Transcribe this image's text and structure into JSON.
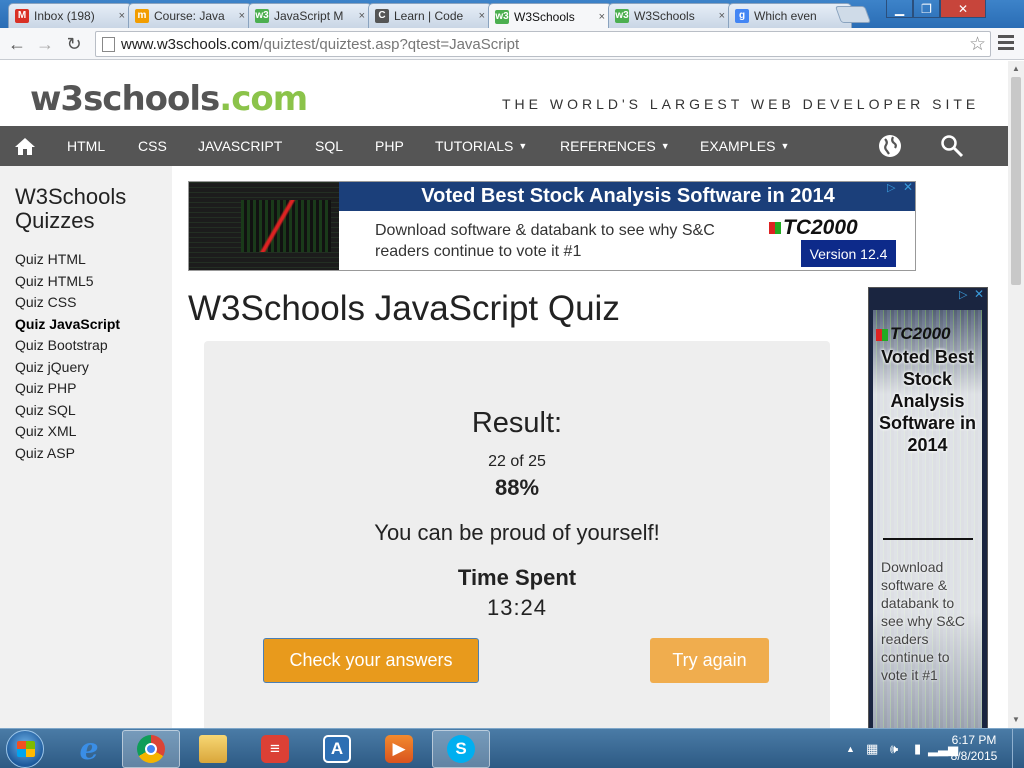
{
  "browser": {
    "tabs": [
      {
        "title": "Inbox (198)",
        "favicon": "gmail-icon",
        "color": "#d93025",
        "glyph": "M",
        "active": false
      },
      {
        "title": "Course: Java",
        "favicon": "moodle-icon",
        "color": "#f29d00",
        "glyph": "m",
        "active": false
      },
      {
        "title": "JavaScript M",
        "favicon": "w3schools-icon",
        "color": "#4caf50",
        "glyph": "w3",
        "active": false
      },
      {
        "title": "Learn | Code",
        "favicon": "codecademy-icon",
        "color": "#555555",
        "glyph": "C",
        "active": false
      },
      {
        "title": "W3Schools",
        "favicon": "w3schools-icon",
        "color": "#4caf50",
        "glyph": "w3",
        "active": true
      },
      {
        "title": "W3Schools",
        "favicon": "w3schools-icon",
        "color": "#4caf50",
        "glyph": "w3",
        "active": false
      },
      {
        "title": "Which even",
        "favicon": "google-icon",
        "color": "#4285f4",
        "glyph": "g",
        "active": false
      }
    ],
    "tab_close": "×",
    "url_host": "www.w3schools.com",
    "url_path": "/quiztest/quiztest.asp?qtest=JavaScript"
  },
  "site": {
    "logo_main": "w3schools",
    "logo_tld": ".com",
    "tagline": "THE WORLD'S LARGEST WEB DEVELOPER SITE",
    "accent_color": "#8bc34a",
    "nav": {
      "html": "HTML",
      "css": "CSS",
      "javascript": "JAVASCRIPT",
      "sql": "SQL",
      "php": "PHP",
      "tutorials": "TUTORIALS",
      "references": "REFERENCES",
      "examples": "EXAMPLES"
    }
  },
  "sidebar": {
    "title_line1": "W3Schools",
    "title_line2": "Quizzes",
    "items": [
      "Quiz HTML",
      "Quiz HTML5",
      "Quiz CSS",
      "Quiz JavaScript",
      "Quiz Bootstrap",
      "Quiz jQuery",
      "Quiz PHP",
      "Quiz SQL",
      "Quiz XML",
      "Quiz ASP"
    ],
    "active_item": "Quiz JavaScript"
  },
  "ad_top": {
    "headline": "Voted Best Stock Analysis Software in 2014",
    "body": "Download software & databank to see why S&C readers continue to vote it #1",
    "brand": "TC2000",
    "version": "Version 12.4"
  },
  "ad_side": {
    "brand": "TC2000",
    "headline": "Voted Best Stock Analysis Software in 2014",
    "body": "Download software & databank to see why S&C readers continue to vote it #1"
  },
  "main": {
    "title": "W3Schools JavaScript Quiz",
    "result_heading": "Result:",
    "score": "22 of 25",
    "percent": "88%",
    "message": "You can be proud of yourself!",
    "time_label": "Time Spent",
    "time_value": "13:24",
    "check_button": "Check your answers",
    "try_button": "Try again",
    "button_color": "#f0ad4e"
  },
  "taskbar": {
    "apps": [
      "internet-explorer",
      "chrome",
      "file-explorer",
      "todoist",
      "app-a",
      "media-player",
      "skype"
    ],
    "time": "6:17 PM",
    "date": "8/8/2015"
  }
}
